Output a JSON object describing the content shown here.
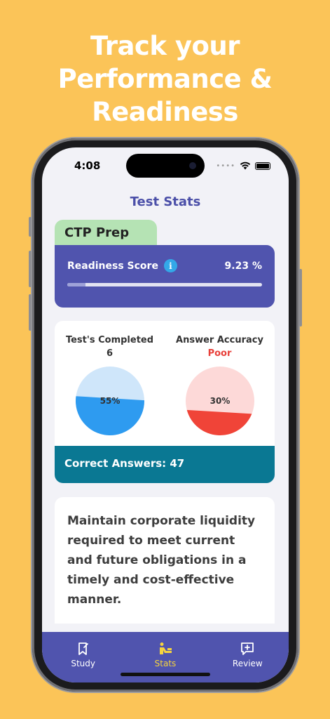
{
  "headline": {
    "line1": "Track your",
    "line2": "Performance &",
    "line3": "Readiness"
  },
  "status": {
    "time": "4:08"
  },
  "nav": {
    "title": "Test Stats"
  },
  "prep": {
    "label": "CTP Prep"
  },
  "readiness": {
    "label": "Readiness Score",
    "value": "9.23 %",
    "progress": 0.0923
  },
  "tests_completed": {
    "title": "Test's Completed",
    "value": "6",
    "pie_label": "55%",
    "percent": 55,
    "color_main": "#2E9BF0",
    "color_rest": "#CFE6FA"
  },
  "accuracy": {
    "title": "Answer Accuracy",
    "rating": "Poor",
    "pie_label": "30%",
    "percent": 30,
    "color_main": "#F04438",
    "color_rest": "#FDD9D8"
  },
  "correct": {
    "label": "Correct Answers: 47"
  },
  "description": {
    "text": "Maintain corporate liquidity required to meet current and future obligations in a timely and cost-effective manner."
  },
  "tabs": [
    {
      "label": "Study",
      "icon": "bookmark-icon"
    },
    {
      "label": "Stats",
      "icon": "stats-person-icon"
    },
    {
      "label": "Review",
      "icon": "review-icon"
    }
  ],
  "colors": {
    "background": "#FBC458",
    "accent": "#5054AE",
    "teal": "#0A7893"
  }
}
